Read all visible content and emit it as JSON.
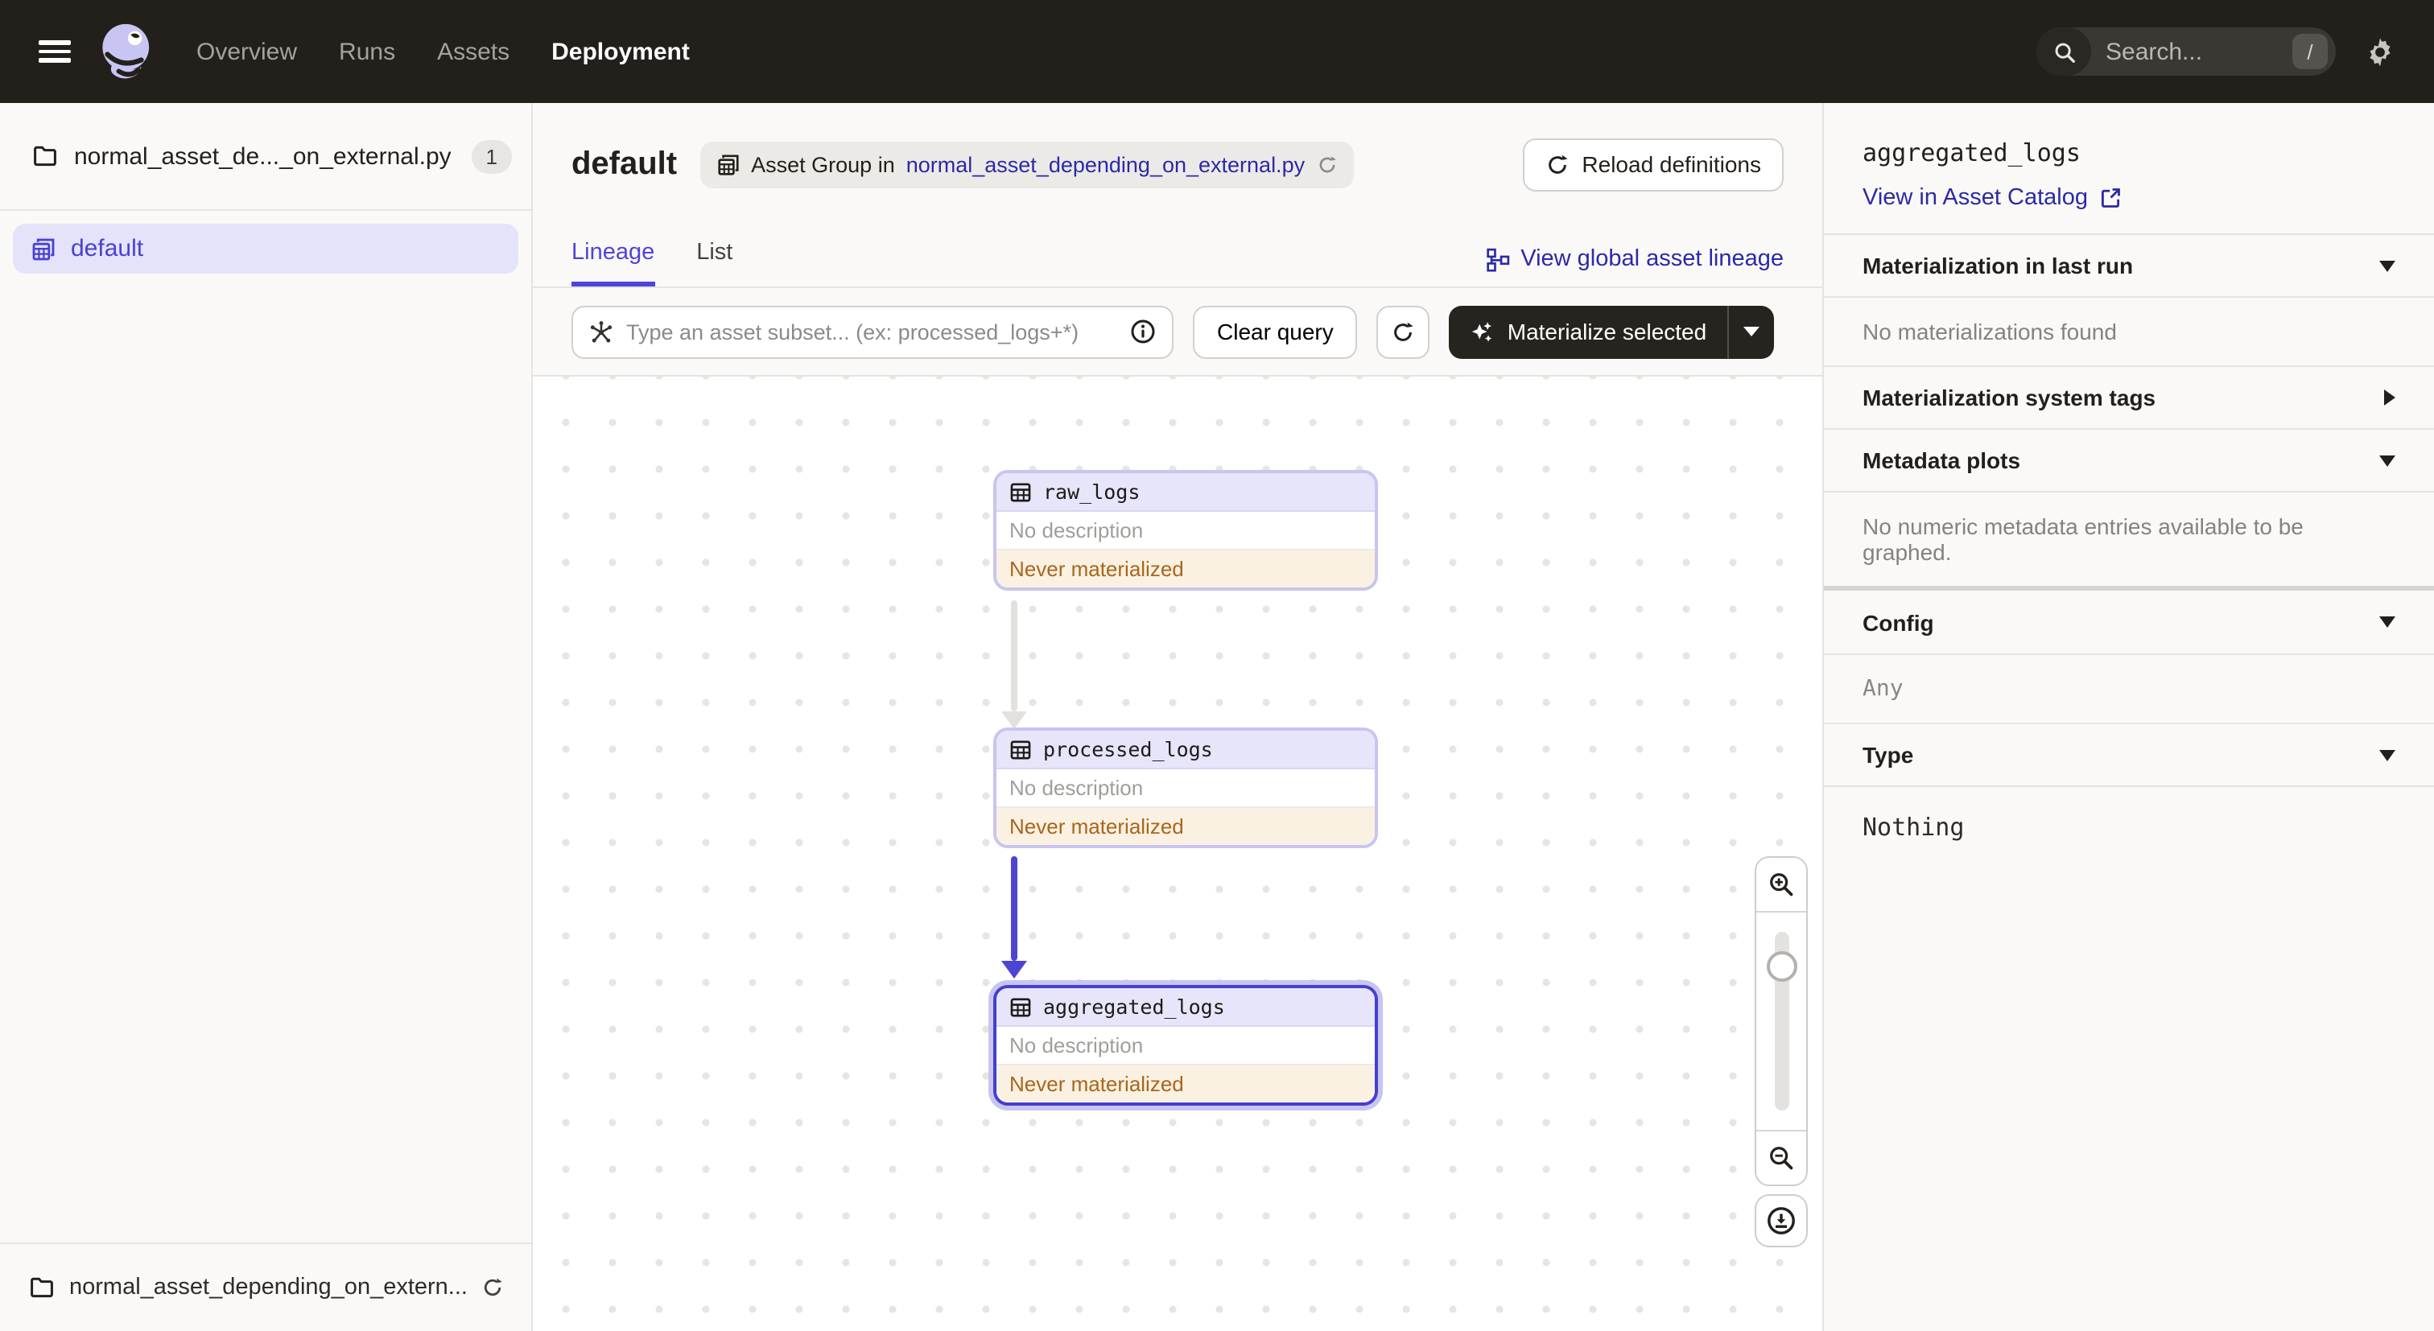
{
  "header": {
    "nav": {
      "overview": "Overview",
      "runs": "Runs",
      "assets": "Assets",
      "deployment": "Deployment"
    },
    "search": {
      "placeholder": "Search...",
      "shortcut": "/"
    }
  },
  "sidebar": {
    "workspace": {
      "label": "normal_asset_de..._on_external.py",
      "count": "1"
    },
    "group": {
      "label": "default"
    },
    "footer": {
      "label": "normal_asset_depending_on_extern..."
    }
  },
  "page": {
    "title": "default",
    "tag": {
      "prefix": "Asset Group in",
      "link": "normal_asset_depending_on_external.py"
    },
    "reload_definitions": "Reload definitions",
    "tabs": {
      "lineage": "Lineage",
      "list": "List"
    },
    "global_lineage_link": "View global asset lineage"
  },
  "toolbar": {
    "query_placeholder": "Type an asset subset... (ex: processed_logs+*)",
    "clear_label": "Clear query",
    "materialize_label": "Materialize selected"
  },
  "graph": {
    "nodes": [
      {
        "name": "raw_logs",
        "description": "No description",
        "status": "Never materialized"
      },
      {
        "name": "processed_logs",
        "description": "No description",
        "status": "Never materialized"
      },
      {
        "name": "aggregated_logs",
        "description": "No description",
        "status": "Never materialized"
      }
    ],
    "selected_node": "aggregated_logs"
  },
  "panel": {
    "title": "aggregated_logs",
    "catalog_link": "View in Asset Catalog",
    "materialization_last_run": {
      "label": "Materialization in last run",
      "empty": "No materializations found"
    },
    "system_tags": {
      "label": "Materialization system tags"
    },
    "metadata_plots": {
      "label": "Metadata plots",
      "empty": "No numeric metadata entries available to be graphed."
    },
    "config": {
      "label": "Config",
      "value": "Any"
    },
    "type": {
      "label": "Type",
      "value": "Nothing"
    }
  },
  "colors": {
    "accent": "#4F43DD",
    "link": "#2B2AA6",
    "header_bg": "#231F1B",
    "node_border": "#C9C5F1",
    "node_selected_border": "#443FD0",
    "node_header_bg": "#E7E5F9",
    "status_bg": "#FBF1E2",
    "status_text": "#A9661C",
    "edge_default": "#E3E1DE",
    "edge_selected": "#4B45D2"
  },
  "icons": [
    "hamburger-icon",
    "dagster-logo",
    "search-icon",
    "slash-shortcut-badge",
    "gear-icon",
    "folder-icon",
    "asset-group-icon",
    "table-icon",
    "reload-icon",
    "info-icon",
    "query-graph-icon",
    "sparkles-icon",
    "chevron-down-icon",
    "lineage-graph-icon",
    "external-link-icon",
    "zoom-in-icon",
    "zoom-out-icon",
    "download-icon"
  ]
}
